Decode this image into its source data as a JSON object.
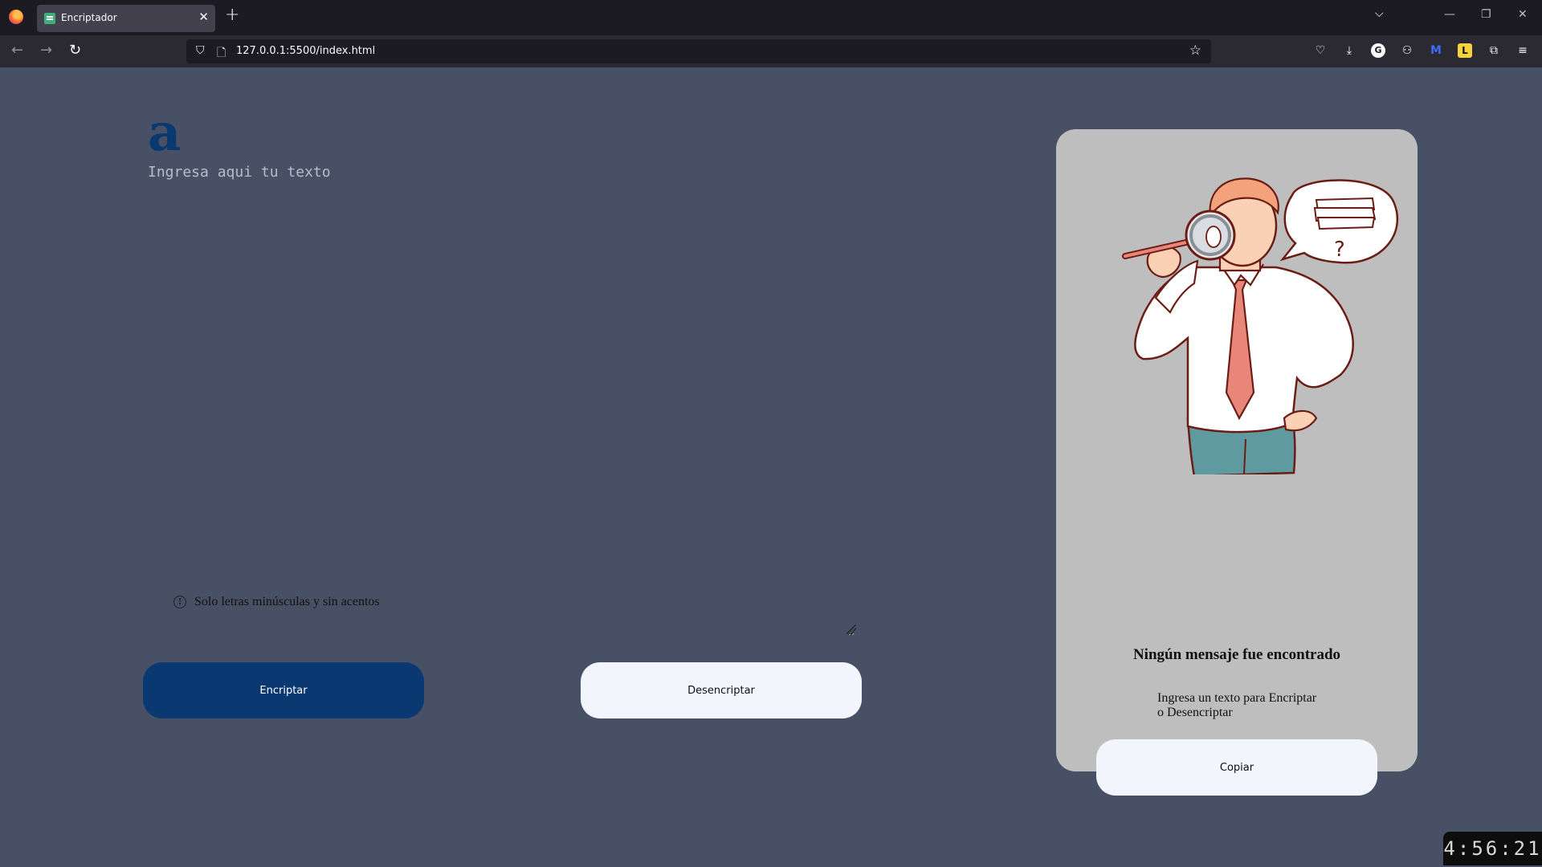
{
  "browser": {
    "tab_title": "Encriptador",
    "url": "127.0.0.1:5500/index.html"
  },
  "page": {
    "logo_letter": "a",
    "textarea_placeholder": "Ingresa aqui tu texto",
    "notice": "Solo letras minúsculas y sin acentos",
    "info_icon": "info-icon",
    "encrypt_label": "Encriptar",
    "decrypt_label": "Desencriptar"
  },
  "panel": {
    "title": "Ningún mensaje fue encontrado",
    "subtitle_line1": "Ingresa un texto para Encriptar",
    "subtitle_line2": "o Desencriptar",
    "copy_label": "Copiar",
    "illustration": "man-with-magnifying-glass",
    "speech_bubble_glyph": "?"
  },
  "clock": "4:56:21",
  "colors": {
    "page_bg": "#475064",
    "accent": "#0a3871",
    "panel_bg": "#bebebe",
    "light_button": "#f3f5fc"
  }
}
